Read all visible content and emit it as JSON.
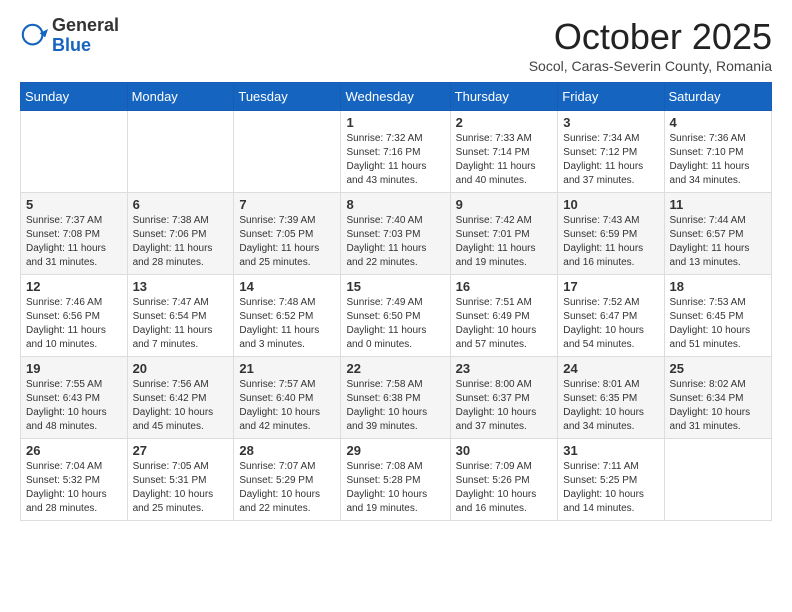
{
  "header": {
    "logo_general": "General",
    "logo_blue": "Blue",
    "title": "October 2025",
    "subtitle": "Socol, Caras-Severin County, Romania"
  },
  "weekdays": [
    "Sunday",
    "Monday",
    "Tuesday",
    "Wednesday",
    "Thursday",
    "Friday",
    "Saturday"
  ],
  "weeks": [
    [
      {
        "day": "",
        "info": ""
      },
      {
        "day": "",
        "info": ""
      },
      {
        "day": "",
        "info": ""
      },
      {
        "day": "1",
        "info": "Sunrise: 7:32 AM\nSunset: 7:16 PM\nDaylight: 11 hours and 43 minutes."
      },
      {
        "day": "2",
        "info": "Sunrise: 7:33 AM\nSunset: 7:14 PM\nDaylight: 11 hours and 40 minutes."
      },
      {
        "day": "3",
        "info": "Sunrise: 7:34 AM\nSunset: 7:12 PM\nDaylight: 11 hours and 37 minutes."
      },
      {
        "day": "4",
        "info": "Sunrise: 7:36 AM\nSunset: 7:10 PM\nDaylight: 11 hours and 34 minutes."
      }
    ],
    [
      {
        "day": "5",
        "info": "Sunrise: 7:37 AM\nSunset: 7:08 PM\nDaylight: 11 hours and 31 minutes."
      },
      {
        "day": "6",
        "info": "Sunrise: 7:38 AM\nSunset: 7:06 PM\nDaylight: 11 hours and 28 minutes."
      },
      {
        "day": "7",
        "info": "Sunrise: 7:39 AM\nSunset: 7:05 PM\nDaylight: 11 hours and 25 minutes."
      },
      {
        "day": "8",
        "info": "Sunrise: 7:40 AM\nSunset: 7:03 PM\nDaylight: 11 hours and 22 minutes."
      },
      {
        "day": "9",
        "info": "Sunrise: 7:42 AM\nSunset: 7:01 PM\nDaylight: 11 hours and 19 minutes."
      },
      {
        "day": "10",
        "info": "Sunrise: 7:43 AM\nSunset: 6:59 PM\nDaylight: 11 hours and 16 minutes."
      },
      {
        "day": "11",
        "info": "Sunrise: 7:44 AM\nSunset: 6:57 PM\nDaylight: 11 hours and 13 minutes."
      }
    ],
    [
      {
        "day": "12",
        "info": "Sunrise: 7:46 AM\nSunset: 6:56 PM\nDaylight: 11 hours and 10 minutes."
      },
      {
        "day": "13",
        "info": "Sunrise: 7:47 AM\nSunset: 6:54 PM\nDaylight: 11 hours and 7 minutes."
      },
      {
        "day": "14",
        "info": "Sunrise: 7:48 AM\nSunset: 6:52 PM\nDaylight: 11 hours and 3 minutes."
      },
      {
        "day": "15",
        "info": "Sunrise: 7:49 AM\nSunset: 6:50 PM\nDaylight: 11 hours and 0 minutes."
      },
      {
        "day": "16",
        "info": "Sunrise: 7:51 AM\nSunset: 6:49 PM\nDaylight: 10 hours and 57 minutes."
      },
      {
        "day": "17",
        "info": "Sunrise: 7:52 AM\nSunset: 6:47 PM\nDaylight: 10 hours and 54 minutes."
      },
      {
        "day": "18",
        "info": "Sunrise: 7:53 AM\nSunset: 6:45 PM\nDaylight: 10 hours and 51 minutes."
      }
    ],
    [
      {
        "day": "19",
        "info": "Sunrise: 7:55 AM\nSunset: 6:43 PM\nDaylight: 10 hours and 48 minutes."
      },
      {
        "day": "20",
        "info": "Sunrise: 7:56 AM\nSunset: 6:42 PM\nDaylight: 10 hours and 45 minutes."
      },
      {
        "day": "21",
        "info": "Sunrise: 7:57 AM\nSunset: 6:40 PM\nDaylight: 10 hours and 42 minutes."
      },
      {
        "day": "22",
        "info": "Sunrise: 7:58 AM\nSunset: 6:38 PM\nDaylight: 10 hours and 39 minutes."
      },
      {
        "day": "23",
        "info": "Sunrise: 8:00 AM\nSunset: 6:37 PM\nDaylight: 10 hours and 37 minutes."
      },
      {
        "day": "24",
        "info": "Sunrise: 8:01 AM\nSunset: 6:35 PM\nDaylight: 10 hours and 34 minutes."
      },
      {
        "day": "25",
        "info": "Sunrise: 8:02 AM\nSunset: 6:34 PM\nDaylight: 10 hours and 31 minutes."
      }
    ],
    [
      {
        "day": "26",
        "info": "Sunrise: 7:04 AM\nSunset: 5:32 PM\nDaylight: 10 hours and 28 minutes."
      },
      {
        "day": "27",
        "info": "Sunrise: 7:05 AM\nSunset: 5:31 PM\nDaylight: 10 hours and 25 minutes."
      },
      {
        "day": "28",
        "info": "Sunrise: 7:07 AM\nSunset: 5:29 PM\nDaylight: 10 hours and 22 minutes."
      },
      {
        "day": "29",
        "info": "Sunrise: 7:08 AM\nSunset: 5:28 PM\nDaylight: 10 hours and 19 minutes."
      },
      {
        "day": "30",
        "info": "Sunrise: 7:09 AM\nSunset: 5:26 PM\nDaylight: 10 hours and 16 minutes."
      },
      {
        "day": "31",
        "info": "Sunrise: 7:11 AM\nSunset: 5:25 PM\nDaylight: 10 hours and 14 minutes."
      },
      {
        "day": "",
        "info": ""
      }
    ]
  ]
}
